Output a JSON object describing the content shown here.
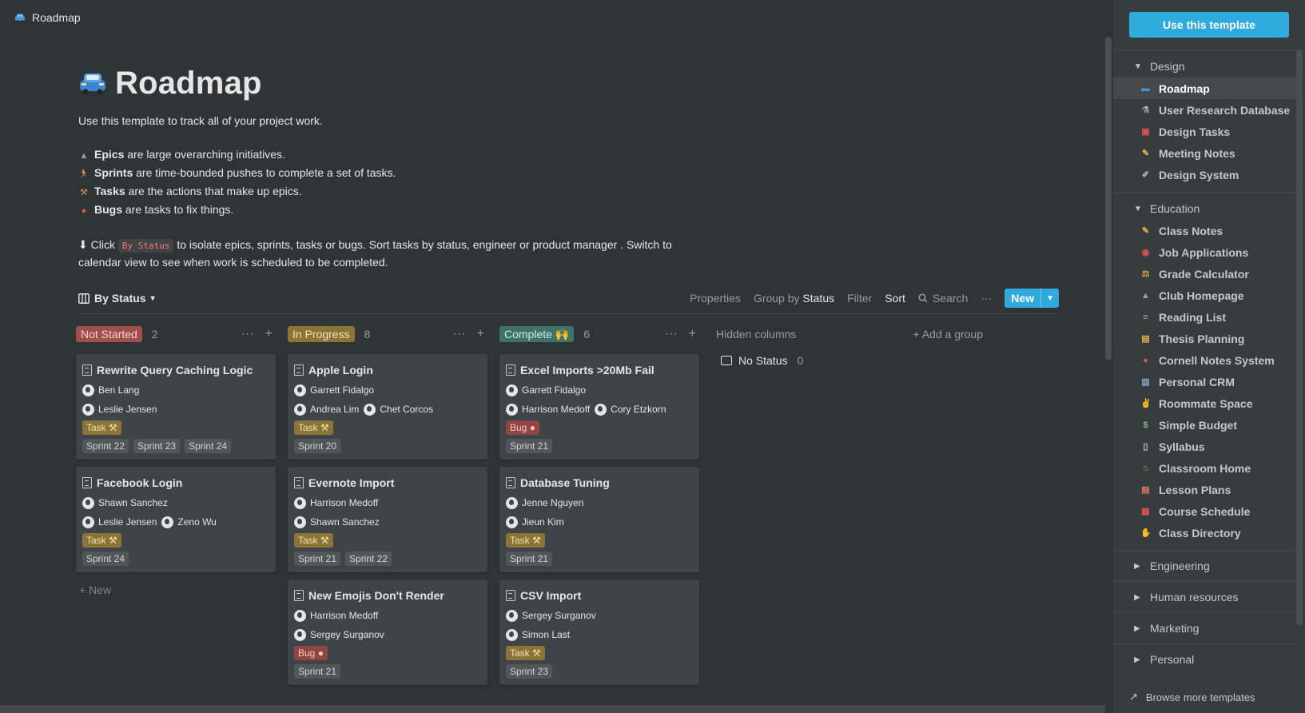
{
  "breadcrumb": "Roadmap",
  "title": "Roadmap",
  "intro": "Use this template to track all of your project work.",
  "legend": [
    {
      "bold": "Epics",
      "text": " are large overarching initiatives.",
      "icon": "⛰",
      "icon_name": "mountain-icon",
      "color": "#8fb08c"
    },
    {
      "bold": "Sprints",
      "text": " are time-bounded pushes to complete a set of tasks.",
      "icon": "🏃",
      "icon_name": "runner-icon",
      "color": "#e0b04b"
    },
    {
      "bold": "Tasks",
      "text": " are the actions that make up epics.",
      "icon": "🔨",
      "icon_name": "hammer-icon",
      "color": "#d9925a"
    },
    {
      "bold": "Bugs",
      "text": " are tasks to fix things.",
      "icon": "🐞",
      "icon_name": "bug-icon",
      "color": "#d9534f"
    }
  ],
  "hint": {
    "prefix": "⬇ Click ",
    "code": "By Status",
    "suffix": " to isolate epics, sprints, tasks or bugs. Sort tasks by status, engineer or product manager . Switch to",
    "line2": "calendar view to see when work is scheduled to be completed."
  },
  "view": {
    "name": "By Status",
    "properties": "Properties",
    "group_by": "Group by",
    "group_value": "Status",
    "filter": "Filter",
    "sort": "Sort",
    "search": "Search",
    "more": "···",
    "new": "New"
  },
  "columns": [
    {
      "label": "Not Started",
      "count": "2",
      "color": "#9f4f4c",
      "text_color": "#f6d0cc",
      "cards": [
        {
          "title": "Rewrite Query Caching Logic",
          "people": [
            [
              "Ben Lang"
            ],
            [
              "Leslie Jensen"
            ]
          ],
          "type": "Task",
          "sprints": [
            "Sprint 22",
            "Sprint 23",
            "Sprint 24"
          ]
        },
        {
          "title": "Facebook Login",
          "people": [
            [
              "Shawn Sanchez"
            ],
            [
              "Leslie Jensen",
              "Zeno Wu"
            ]
          ],
          "type": "Task",
          "sprints": [
            "Sprint 24"
          ]
        }
      ],
      "add_new": "+ New"
    },
    {
      "label": "In Progress",
      "count": "8",
      "color": "#8c7436",
      "text_color": "#f0e1b4",
      "cards": [
        {
          "title": "Apple Login",
          "people": [
            [
              "Garrett Fidalgo"
            ],
            [
              "Andrea Lim",
              "Chet Corcos"
            ]
          ],
          "type": "Task",
          "sprints": [
            "Sprint 20"
          ]
        },
        {
          "title": "Evernote Import",
          "people": [
            [
              "Harrison Medoff"
            ],
            [
              "Shawn Sanchez"
            ]
          ],
          "type": "Task",
          "sprints": [
            "Sprint 21",
            "Sprint 22"
          ]
        },
        {
          "title": "New Emojis Don't Render",
          "people": [
            [
              "Harrison Medoff"
            ],
            [
              "Sergey Surganov"
            ]
          ],
          "type": "Bug",
          "sprints": [
            "Sprint 21"
          ]
        }
      ]
    },
    {
      "label": "Complete 🙌",
      "count": "6",
      "color": "#3f7268",
      "text_color": "#c9ece1",
      "cards": [
        {
          "title": "Excel Imports >20Mb Fail",
          "people": [
            [
              "Garrett Fidalgo"
            ],
            [
              "Harrison Medoff",
              "Cory Etzkorn"
            ]
          ],
          "type": "Bug",
          "sprints": [
            "Sprint 21"
          ]
        },
        {
          "title": "Database Tuning",
          "people": [
            [
              "Jenne Nguyen"
            ],
            [
              "Jieun Kim"
            ]
          ],
          "type": "Task",
          "sprints": [
            "Sprint 21"
          ]
        },
        {
          "title": "CSV Import",
          "people": [
            [
              "Sergey Surganov"
            ],
            [
              "Simon Last"
            ]
          ],
          "type": "Task",
          "sprints": [
            "Sprint 23"
          ]
        }
      ]
    }
  ],
  "hidden_columns": "Hidden columns",
  "add_group": "+ Add a group",
  "no_status": {
    "label": "No Status",
    "count": "0"
  },
  "sidebar": {
    "use_template": "Use this template",
    "sections": [
      {
        "name": "Design",
        "open": true,
        "items": [
          {
            "label": "Roadmap",
            "icon": "🚙",
            "icon_name": "car-icon",
            "active": true
          },
          {
            "label": "User Research Database",
            "icon": "🔬",
            "icon_name": "microscope-icon"
          },
          {
            "label": "Design Tasks",
            "icon": "🎒",
            "icon_name": "backpack-icon"
          },
          {
            "label": "Meeting Notes",
            "icon": "✏",
            "icon_name": "pencil-icon"
          },
          {
            "label": "Design System",
            "icon": "🖌",
            "icon_name": "brush-icon"
          }
        ]
      },
      {
        "name": "Education",
        "open": true,
        "items": [
          {
            "label": "Class Notes",
            "icon": "✏",
            "icon_name": "pencil-icon"
          },
          {
            "label": "Job Applications",
            "icon": "👥",
            "icon_name": "people-icon"
          },
          {
            "label": "Grade Calculator",
            "icon": "⚖",
            "icon_name": "scale-icon"
          },
          {
            "label": "Club Homepage",
            "icon": "⛺",
            "icon_name": "tent-icon"
          },
          {
            "label": "Reading List",
            "icon": "📚",
            "icon_name": "books-icon"
          },
          {
            "label": "Thesis Planning",
            "icon": "📒",
            "icon_name": "notebook-icon"
          },
          {
            "label": "Cornell Notes System",
            "icon": "📍",
            "icon_name": "pin-icon"
          },
          {
            "label": "Personal CRM",
            "icon": "📇",
            "icon_name": "cardfile-icon"
          },
          {
            "label": "Roommate Space",
            "icon": "✌",
            "icon_name": "peace-hand-icon"
          },
          {
            "label": "Simple Budget",
            "icon": "💸",
            "icon_name": "money-icon"
          },
          {
            "label": "Syllabus",
            "icon": "📄",
            "icon_name": "page-icon"
          },
          {
            "label": "Classroom Home",
            "icon": "🏫",
            "icon_name": "school-icon"
          },
          {
            "label": "Lesson Plans",
            "icon": "📓",
            "icon_name": "notebook-icon"
          },
          {
            "label": "Course Schedule",
            "icon": "📅",
            "icon_name": "calendar-icon"
          },
          {
            "label": "Class Directory",
            "icon": "👋",
            "icon_name": "wave-icon"
          }
        ]
      },
      {
        "name": "Engineering",
        "open": false,
        "items": []
      },
      {
        "name": "Human resources",
        "open": false,
        "items": []
      },
      {
        "name": "Marketing",
        "open": false,
        "items": []
      },
      {
        "name": "Personal",
        "open": false,
        "items": []
      }
    ],
    "browse": "Browse more templates"
  }
}
